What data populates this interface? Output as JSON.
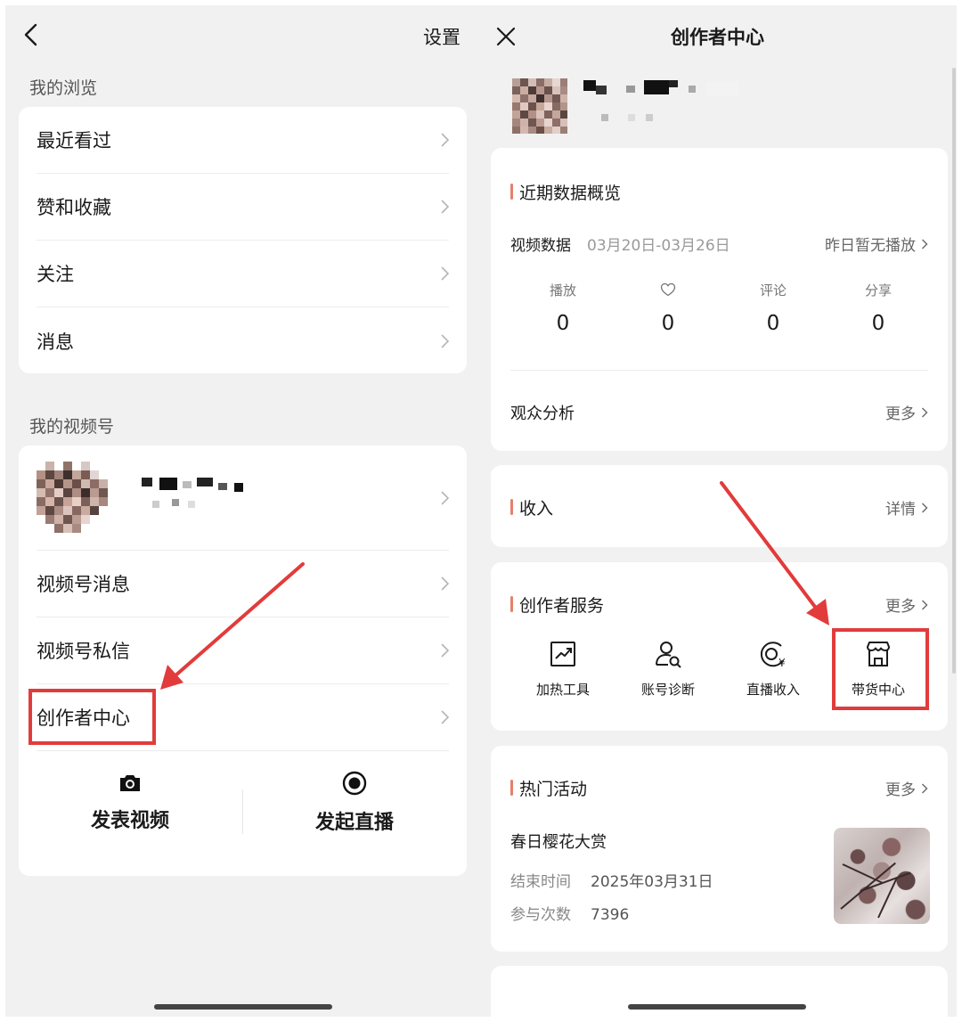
{
  "left": {
    "settings_label": "设置",
    "browse_section_title": "我的浏览",
    "browse_items": [
      {
        "label": "最近看过"
      },
      {
        "label": "赞和收藏"
      },
      {
        "label": "关注"
      },
      {
        "label": "消息"
      }
    ],
    "channel_section_title": "我的视频号",
    "channel_items": [
      {
        "label": "视频号消息"
      },
      {
        "label": "视频号私信"
      },
      {
        "label": "创作者中心"
      }
    ],
    "actions": [
      {
        "label": "发表视频",
        "icon": "camera-icon"
      },
      {
        "label": "发起直播",
        "icon": "live-record-icon"
      }
    ]
  },
  "right": {
    "title": "创作者中心",
    "overview": {
      "title": "近期数据概览",
      "video_data_label": "视频数据",
      "date_range": "03月20日-03月26日",
      "no_play_label": "昨日暂无播放",
      "stats": [
        {
          "label": "播放",
          "value": "0"
        },
        {
          "label": "",
          "icon": "heart-icon",
          "value": "0"
        },
        {
          "label": "评论",
          "value": "0"
        },
        {
          "label": "分享",
          "value": "0"
        }
      ],
      "audience_label": "观众分析",
      "audience_more": "更多"
    },
    "income": {
      "title": "收入",
      "more": "详情"
    },
    "services": {
      "title": "创作者服务",
      "more": "更多",
      "items": [
        {
          "label": "加热工具",
          "icon": "trend-chart-icon"
        },
        {
          "label": "账号诊断",
          "icon": "user-search-icon"
        },
        {
          "label": "直播收入",
          "icon": "live-yuan-icon"
        },
        {
          "label": "带货中心",
          "icon": "shop-icon"
        }
      ]
    },
    "events": {
      "title": "热门活动",
      "more": "更多",
      "event_name": "春日樱花大赏",
      "end_time_label": "结束时间",
      "end_time_value": "2025年03月31日",
      "participants_label": "参与次数",
      "participants_value": "7396"
    }
  },
  "colors": {
    "highlight_red": "#e23b3b",
    "accent_bar": "#e5806a",
    "panel_bg": "#f1f1f1"
  }
}
